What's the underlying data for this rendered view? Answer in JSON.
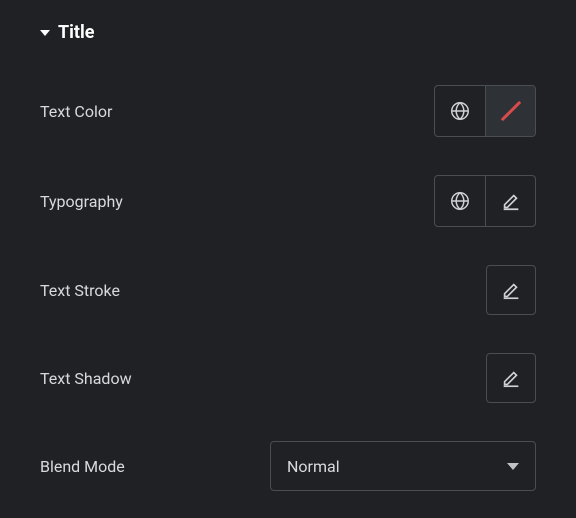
{
  "section": {
    "title": "Title"
  },
  "rows": {
    "text_color": {
      "label": "Text Color"
    },
    "typography": {
      "label": "Typography"
    },
    "text_stroke": {
      "label": "Text Stroke"
    },
    "text_shadow": {
      "label": "Text Shadow"
    },
    "blend_mode": {
      "label": "Blend Mode",
      "value": "Normal"
    }
  }
}
